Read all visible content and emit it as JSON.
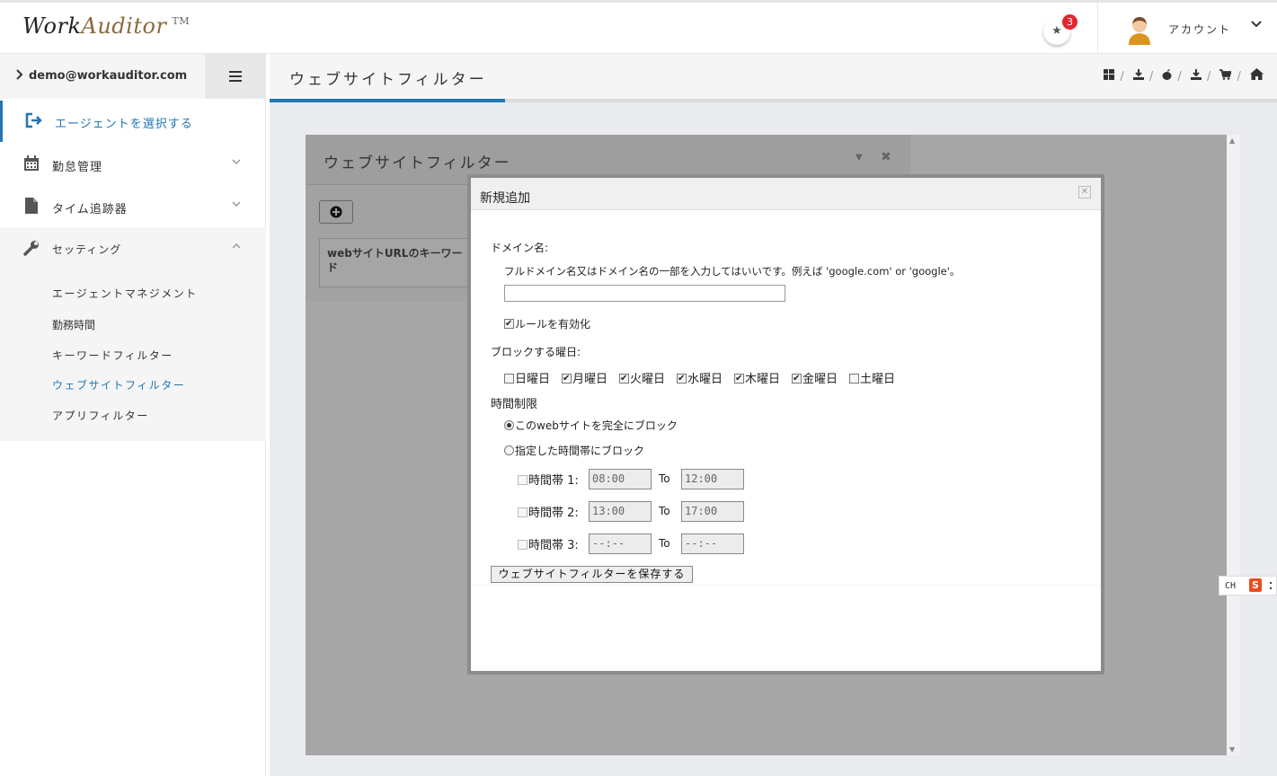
{
  "app": {
    "logo_work": "Work",
    "logo_auditor": "Auditor",
    "logo_tm": "TM",
    "notification_count": "3",
    "account_label": "アカウント"
  },
  "sidebar": {
    "user_email": "demo@workauditor.com",
    "items": [
      {
        "label": "エージェントを選択する",
        "icon": "sign-in-icon",
        "active": true
      },
      {
        "label": "勤怠管理",
        "icon": "calendar-icon"
      },
      {
        "label": "タイム追跡器",
        "icon": "file-icon"
      },
      {
        "label": "セッティング",
        "icon": "wrench-icon",
        "expanded": true
      }
    ],
    "settings_sub": [
      {
        "label": "エージェントマネジメント"
      },
      {
        "label": "勤務時間"
      },
      {
        "label": "キーワードフィルター"
      },
      {
        "label": "ウェブサイトフィルター",
        "active": true
      },
      {
        "label": "アプリフィルター"
      }
    ]
  },
  "header": {
    "title": "ウェブサイトフィルター",
    "icons": [
      "windows-icon",
      "download-icon",
      "apple-icon",
      "download-icon",
      "cart-icon",
      "home-icon"
    ]
  },
  "panel": {
    "title": "ウェブサイトフィルター",
    "column_header": "webサイトURLのキーワード"
  },
  "modal": {
    "title": "新規追加",
    "domain_label": "ドメイン名:",
    "domain_help": "フルドメイン名又はドメイン名の一部を入力してはいいです。例えば 'google.com' or 'google'。",
    "domain_value": "",
    "enable_rule_label": "ルールを有効化",
    "enable_rule_checked": true,
    "block_days_label": "ブロックする曜日:",
    "days": [
      {
        "label": "日曜日",
        "checked": false
      },
      {
        "label": "月曜日",
        "checked": true
      },
      {
        "label": "火曜日",
        "checked": true
      },
      {
        "label": "水曜日",
        "checked": true
      },
      {
        "label": "木曜日",
        "checked": true
      },
      {
        "label": "金曜日",
        "checked": true
      },
      {
        "label": "土曜日",
        "checked": false
      }
    ],
    "time_limit_label": "時間制限",
    "block_all_label": "このwebサイトを完全にブロック",
    "block_range_label": "指定した時間帯にブロック",
    "to_label": "To",
    "slots": [
      {
        "label": "時間帯 1:",
        "from": "08:00",
        "to": "12:00"
      },
      {
        "label": "時間帯 2:",
        "from": "13:00",
        "to": "17:00"
      },
      {
        "label": "時間帯 3:",
        "from": "--:--",
        "to": "--:--"
      }
    ],
    "save_label": "ウェブサイトフィルターを保存する"
  },
  "ime": {
    "label": "CH",
    "logo_letter": "S"
  }
}
